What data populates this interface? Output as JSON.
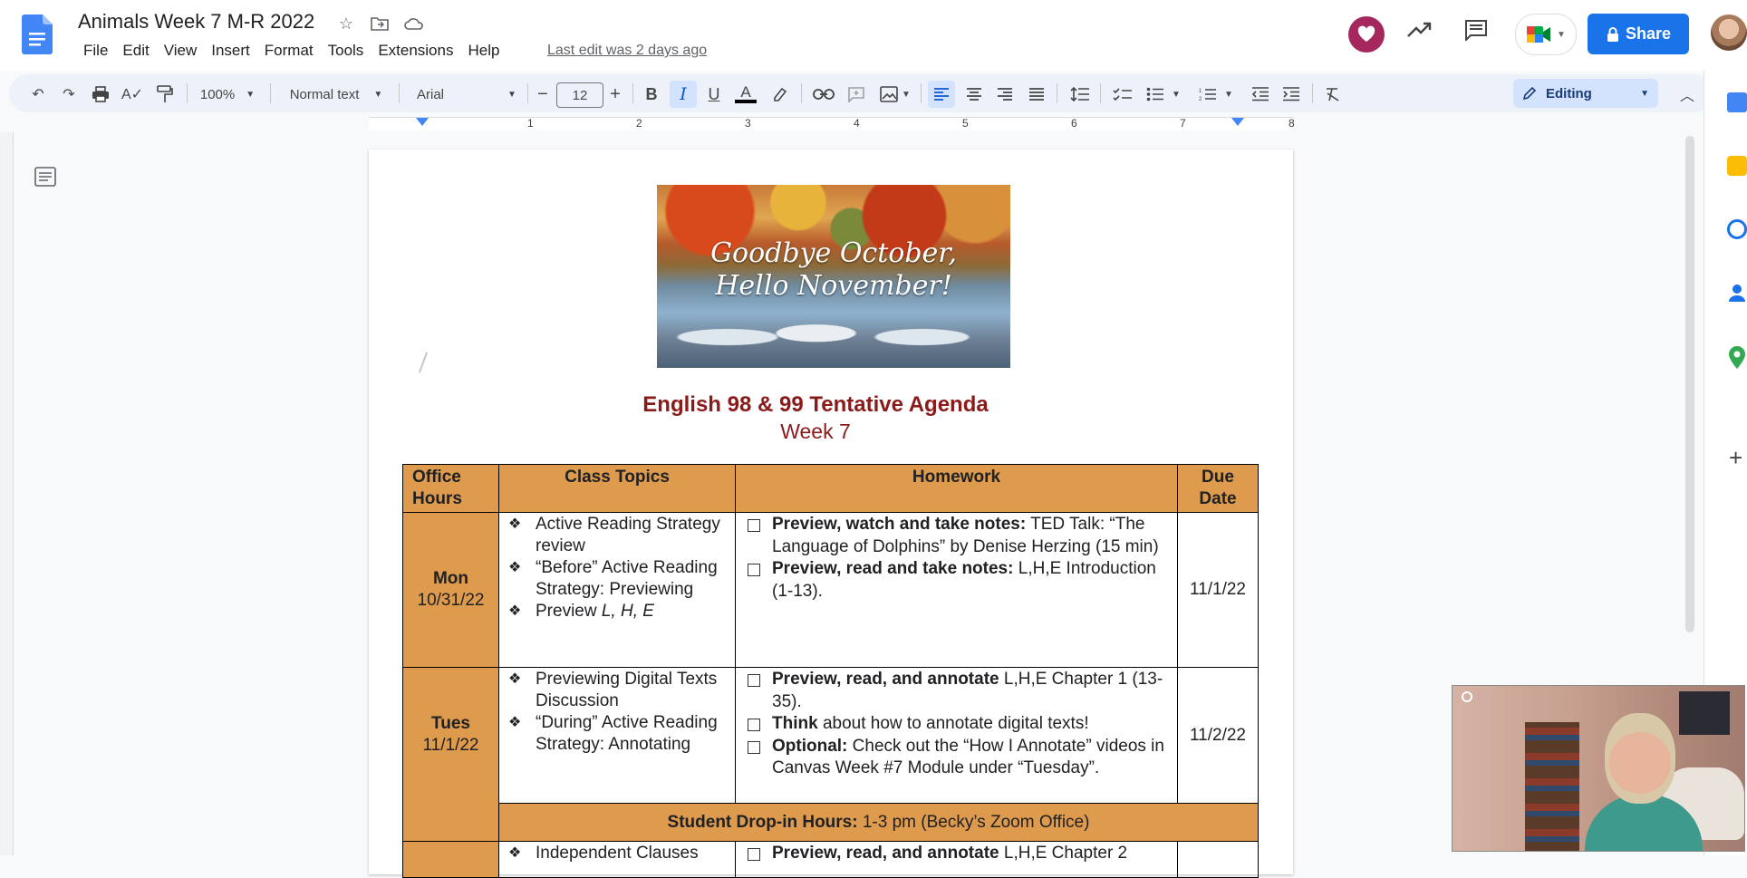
{
  "app": {
    "doc_title": "Animals Week 7 M-R 2022",
    "menu": [
      "File",
      "Edit",
      "View",
      "Insert",
      "Format",
      "Tools",
      "Extensions",
      "Help"
    ],
    "last_edit": "Last edit was 2 days ago",
    "share_label": "Share",
    "brand_color": "#1a73e8"
  },
  "toolbar": {
    "zoom": "100%",
    "style": "Normal text",
    "font": "Arial",
    "font_size": "12",
    "mode": "Editing"
  },
  "ruler": {
    "marks": [
      "1",
      "2",
      "3",
      "4",
      "5",
      "6",
      "7",
      "8"
    ]
  },
  "document": {
    "banner_line1": "Goodbye October,",
    "banner_line2": "Hello November!",
    "title": "English 98 & 99 Tentative Agenda",
    "subtitle": "Week 7",
    "table": {
      "headers": [
        "Office Hours",
        "Class Topics",
        "Homework",
        "Due Date"
      ],
      "rows": [
        {
          "day": "Mon",
          "date": "10/31/22",
          "topics": [
            "Active Reading Strategy review",
            "“Before” Active Reading Strategy: Previewing",
            "Preview L, H, E"
          ],
          "homework": [
            {
              "bold": "Preview, watch  and take notes:",
              "text": " TED Talk: “The Language of Dolphins” by Denise Herzing (15 min)"
            },
            {
              "bold": "Preview, read and take notes:",
              "text": " L,H,E Introduction (1-13)."
            }
          ],
          "due": "11/1/22"
        },
        {
          "day": "Tues",
          "date": "11/1/22",
          "topics": [
            "Previewing Digital Texts Discussion",
            "“During” Active Reading Strategy: Annotating"
          ],
          "homework": [
            {
              "bold": "Preview, read, and annotate",
              "text": " L,H,E Chapter 1 (13-35)."
            },
            {
              "bold": "Think",
              "text": " about how to annotate digital texts!"
            },
            {
              "bold": "Optional:",
              "text": " Check out the “How I Annotate” videos in Canvas Week #7 Module under “Tuesday”."
            }
          ],
          "due": "11/2/22"
        }
      ],
      "dropin_bold": "Student Drop-in Hours:",
      "dropin_text": " 1-3 pm (Becky’s Zoom Office)",
      "partial_topic": "Independent Clauses",
      "partial_hw_bold": "Preview, read, and annotate",
      "partial_hw_text": " L,H,E Chapter 2"
    },
    "accent_color": "#de9a4d",
    "title_color": "#8b1a1a"
  },
  "icons": [
    "docs-logo-icon",
    "star-icon",
    "move-icon",
    "cloud-icon",
    "kebab-heart-icon",
    "trending-icon",
    "comment-icon",
    "meet-icon",
    "undo-icon",
    "redo-icon",
    "print-icon",
    "spellcheck-icon",
    "paint-format-icon",
    "bold-icon",
    "italic-icon",
    "underline-icon",
    "text-color-icon",
    "highlight-icon",
    "link-icon",
    "add-comment-icon",
    "image-icon",
    "align-left-icon",
    "align-center-icon",
    "align-right-icon",
    "justify-icon",
    "line-spacing-icon",
    "checklist-icon",
    "bullet-list-icon",
    "numbered-list-icon",
    "indent-decrease-icon",
    "indent-increase-icon",
    "clear-format-icon",
    "outline-icon"
  ]
}
